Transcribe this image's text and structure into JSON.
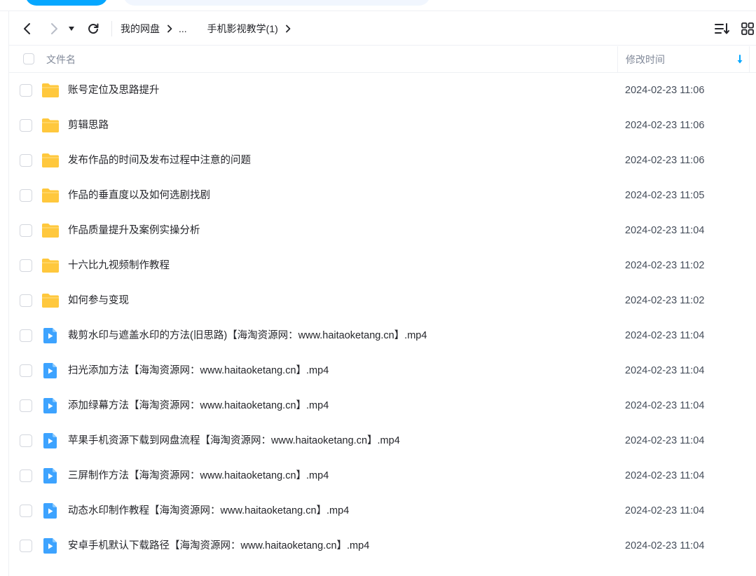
{
  "toolbar": {
    "back_icon": "chevron-left-icon",
    "forward_icon": "chevron-right-icon",
    "history_icon": "caret-down-icon",
    "refresh_icon": "refresh-icon",
    "breadcrumb": [
      "我的网盘",
      "...",
      "手机影视教学(1)"
    ],
    "sort_list_icon": "sort-list-icon",
    "grid_view_icon": "grid-view-icon"
  },
  "header": {
    "name_label": "文件名",
    "time_label": "修改时间",
    "sort_icon": "arrow-down-icon"
  },
  "colors": {
    "accent": "#06a7ff",
    "folder": "#ffc83d",
    "video_icon": "#3da3ff"
  },
  "files": [
    {
      "type": "folder",
      "name": "账号定位及思路提升",
      "time": "2024-02-23 11:06"
    },
    {
      "type": "folder",
      "name": "剪辑思路",
      "time": "2024-02-23 11:06"
    },
    {
      "type": "folder",
      "name": "发布作品的时间及发布过程中注意的问题",
      "time": "2024-02-23 11:06"
    },
    {
      "type": "folder",
      "name": "作品的垂直度以及如何选剧找剧",
      "time": "2024-02-23 11:05"
    },
    {
      "type": "folder",
      "name": "作品质量提升及案例实操分析",
      "time": "2024-02-23 11:04"
    },
    {
      "type": "folder",
      "name": "十六比九视频制作教程",
      "time": "2024-02-23 11:02"
    },
    {
      "type": "folder",
      "name": "如何参与变现",
      "time": "2024-02-23 11:02"
    },
    {
      "type": "video",
      "name": "裁剪水印与遮盖水印的方法(旧思路)【海淘资源网：www.haitaoketang.cn】.mp4",
      "time": "2024-02-23 11:04"
    },
    {
      "type": "video",
      "name": "扫光添加方法【海淘资源网：www.haitaoketang.cn】.mp4",
      "time": "2024-02-23 11:04"
    },
    {
      "type": "video",
      "name": "添加绿幕方法【海淘资源网：www.haitaoketang.cn】.mp4",
      "time": "2024-02-23 11:04"
    },
    {
      "type": "video",
      "name": "苹果手机资源下载到网盘流程【海淘资源网：www.haitaoketang.cn】.mp4",
      "time": "2024-02-23 11:04"
    },
    {
      "type": "video",
      "name": "三屏制作方法【海淘资源网：www.haitaoketang.cn】.mp4",
      "time": "2024-02-23 11:04"
    },
    {
      "type": "video",
      "name": "动态水印制作教程【海淘资源网：www.haitaoketang.cn】.mp4",
      "time": "2024-02-23 11:04"
    },
    {
      "type": "video",
      "name": "安卓手机默认下载路径【海淘资源网：www.haitaoketang.cn】.mp4",
      "time": "2024-02-23 11:04"
    }
  ]
}
